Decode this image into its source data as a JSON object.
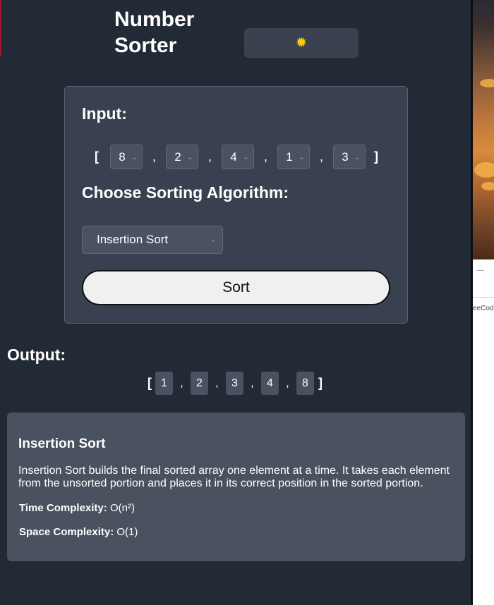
{
  "header": {
    "title": "Number Sorter",
    "theme_icon": "sun-icon"
  },
  "input": {
    "heading": "Input:",
    "open_bracket": "[",
    "close_bracket": "]",
    "separator": ",",
    "values": [
      "8",
      "2",
      "4",
      "1",
      "3"
    ]
  },
  "algorithm": {
    "heading": "Choose Sorting Algorithm:",
    "selected": "Insertion Sort"
  },
  "sort_button": {
    "label": "Sort"
  },
  "output": {
    "heading": "Output:",
    "values": [
      "1",
      "2",
      "3",
      "4",
      "8"
    ]
  },
  "info": {
    "title": "Insertion Sort",
    "description": "Insertion Sort builds the final sorted array one element at a time. It takes each element from the unsorted portion and places it in its correct position in the sorted portion.",
    "time_label": "Time Complexity:",
    "time_value": "O(n²)",
    "space_label": "Space Complexity:",
    "space_value": "O(1)"
  },
  "side_panel": {
    "dash": "—",
    "text": "eeCod"
  },
  "colors": {
    "background": "#222a36",
    "card": "#394150",
    "info_card": "#4a5260",
    "sun": "#ffcc00"
  }
}
